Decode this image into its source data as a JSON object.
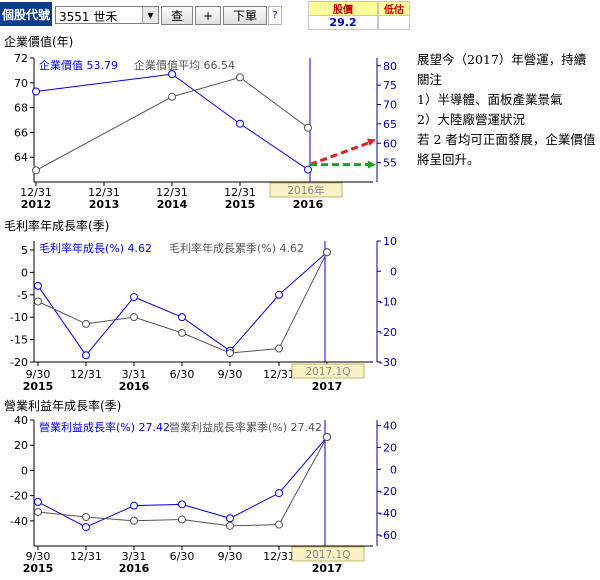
{
  "toolbar": {
    "stock_label": "個股代號",
    "stock_value": "3551 世禾",
    "dropdown_icon": "chevron-down-icon",
    "query_label": "查",
    "plus_label": "+",
    "next_label": "下單",
    "help_label": "?"
  },
  "price": {
    "header1": "股價",
    "value1": "29.2",
    "header2": "低估"
  },
  "colors": {
    "blue": "#0000ee",
    "gray": "#555555",
    "red": "#e02020",
    "green": "#20a020",
    "axis_blue": "#0000aa",
    "tag_bg": "#f7f3c6"
  },
  "note": {
    "lines": [
      "展望今（2017）年營運，持續關注",
      "1）半導體、面板產業景氣",
      "2）大陸廠營運狀況",
      "若 2 者均可正面發展，企業價值將呈回升。"
    ]
  },
  "chart_data": [
    {
      "type": "line",
      "title": "企業價值(年)",
      "categories": [
        "12/31\n2012",
        "12/31\n2013",
        "12/31\n2014",
        "12/31\n2015",
        "12/31\n2016"
      ],
      "left_ylim": [
        62,
        72
      ],
      "left_ticks": [
        64,
        66,
        68,
        70,
        72
      ],
      "right_ylim": [
        50,
        82
      ],
      "right_ticks": [
        55,
        60,
        65,
        70,
        75,
        80
      ],
      "series": [
        {
          "name": "企業價值",
          "axis": "left",
          "color": "#0000ee",
          "values": [
            69.3,
            null,
            70.7,
            66.7,
            63.0
          ],
          "legend": "企業價值 53.79"
        },
        {
          "name": "企業價值平均",
          "axis": "right",
          "color": "#555555",
          "values": [
            53.0,
            null,
            72.0,
            77.0,
            64.0
          ],
          "legend": "企業價值平均 66.54"
        }
      ],
      "highlight_label": "2016年",
      "annotations": [
        {
          "style": "dashed-arrow",
          "color": "#e02020",
          "from": [
            4,
            54.5
          ],
          "to": [
            5,
            61
          ]
        },
        {
          "style": "dashed-arrow",
          "color": "#20a020",
          "from": [
            4,
            54.5
          ],
          "to": [
            5,
            54.5
          ]
        }
      ]
    },
    {
      "type": "line",
      "title": "毛利率年成長率(季)",
      "categories": [
        "9/30\n2015",
        "12/31",
        "3/31\n2016",
        "6/30",
        "9/30",
        "12/31",
        "3/31\n2017"
      ],
      "left_ylim": [
        -20,
        7
      ],
      "left_ticks": [
        5,
        0,
        -5,
        -10,
        -15,
        -20
      ],
      "right_ylim": [
        -30,
        10
      ],
      "right_ticks": [
        10,
        0,
        -10,
        -20,
        -30
      ],
      "series": [
        {
          "name": "毛利率年成長(%)",
          "axis": "left",
          "color": "#0000ee",
          "values": [
            -3,
            -18.5,
            -5.5,
            -10,
            -17.5,
            -5,
            4.5
          ],
          "legend": "毛利率年成長(%) 4.62"
        },
        {
          "name": "毛利率年成長累季(%)",
          "axis": "left",
          "color": "#555555",
          "values": [
            -6.5,
            -11.5,
            -10,
            -13.5,
            -18,
            -17,
            4.5
          ],
          "legend": "毛利率年成長累季(%) 4.62"
        }
      ],
      "highlight_label": "2017.1Q"
    },
    {
      "type": "line",
      "title": "營業利益年成長率(季)",
      "categories": [
        "9/30\n2015",
        "12/31",
        "3/31\n2016",
        "6/30",
        "9/30",
        "12/31",
        "3/31\n2017"
      ],
      "left_ylim": [
        -60,
        40
      ],
      "left_ticks": [
        40,
        20,
        0,
        -20,
        -40
      ],
      "right_ylim": [
        -70,
        45
      ],
      "right_ticks": [
        40,
        20,
        0,
        -20,
        -40,
        -60
      ],
      "series": [
        {
          "name": "營業利益成長率(%)",
          "axis": "left",
          "color": "#0000ee",
          "values": [
            -25,
            -45,
            -28,
            -27,
            -38,
            -18,
            26.5
          ],
          "legend": "營業利益成長率(%) 27.42"
        },
        {
          "name": "營業利益成長率累季(%)",
          "axis": "left",
          "color": "#555555",
          "values": [
            -33,
            -37,
            -40,
            -39,
            -44,
            -43,
            26.5
          ],
          "legend": "營業利益成長率累季(%) 27.42"
        }
      ],
      "highlight_label": "2017.1Q"
    }
  ]
}
